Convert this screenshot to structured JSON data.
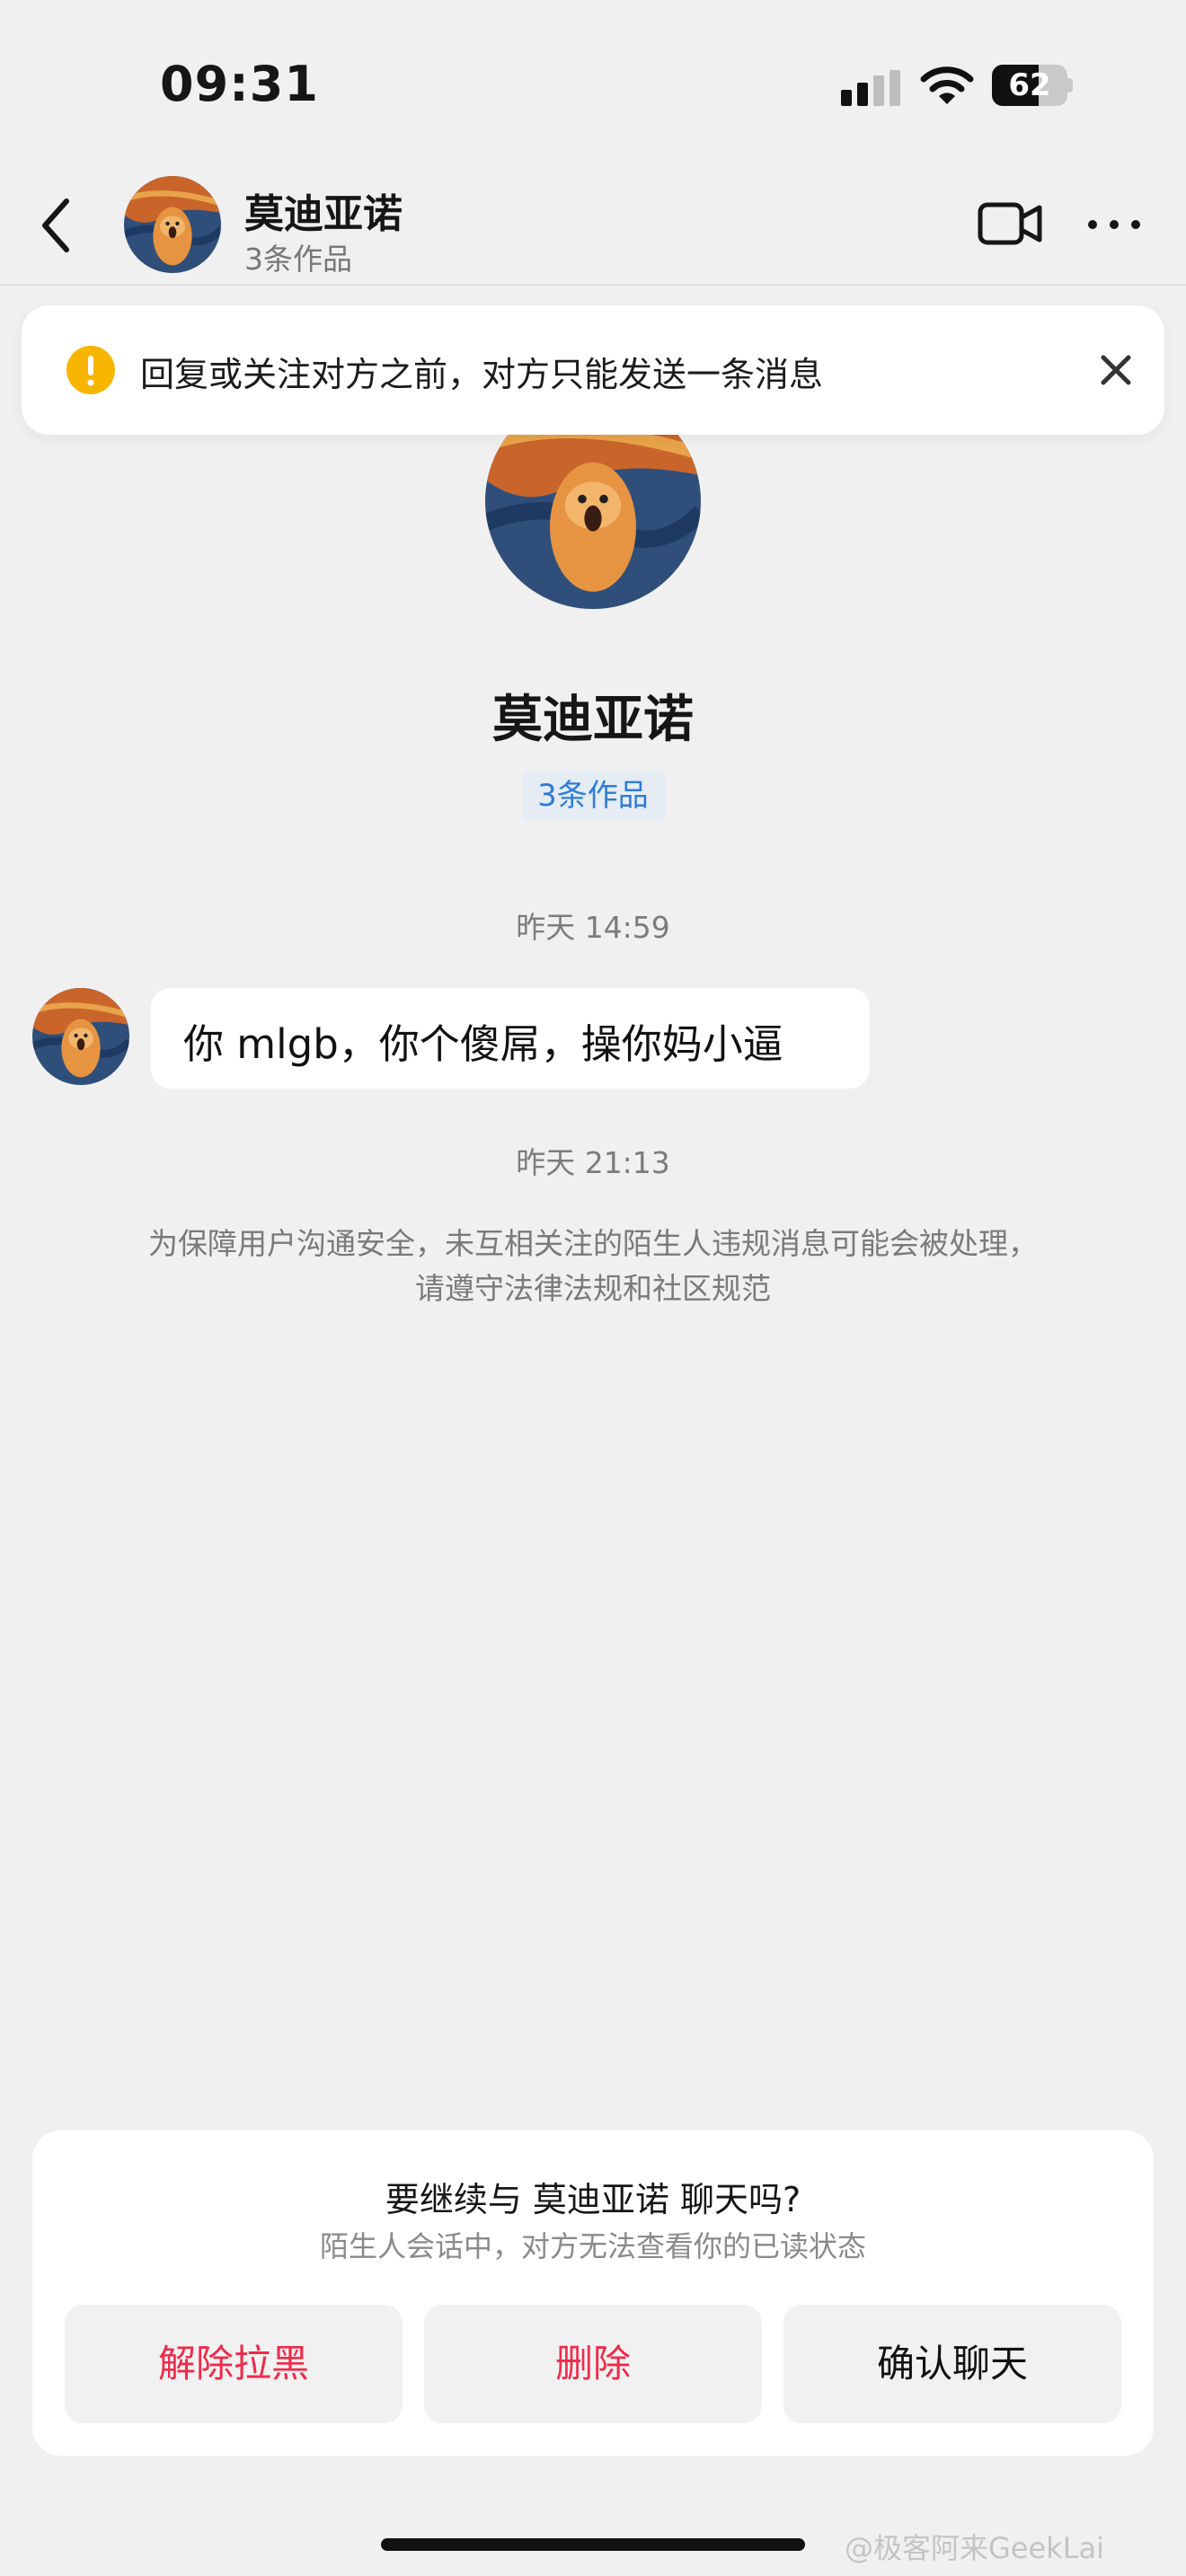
{
  "status_bar": {
    "time": "09:31",
    "battery": "62",
    "battery_level": 0.62
  },
  "header": {
    "name": "莫迪亚诺",
    "subtitle": "3条作品"
  },
  "banner": {
    "text": "回复或关注对方之前，对方只能发送一条消息"
  },
  "profile": {
    "name": "莫迪亚诺",
    "works": "3条作品"
  },
  "chat": {
    "timestamp_1": "昨天 14:59",
    "message_1": "你 mlgb，你个傻屌，操你妈小逼",
    "timestamp_2": "昨天 21:13",
    "system_notice": "为保障用户沟通安全，未互相关注的陌生人违规消息可能会被处理，请遵守法律法规和社区规范"
  },
  "prompt": {
    "title": "要继续与 莫迪亚诺 聊天吗?",
    "subtitle": "陌生人会话中，对方无法查看你的已读状态",
    "unblock_label": "解除拉黑",
    "delete_label": "删除",
    "confirm_label": "确认聊天"
  },
  "watermark": "@极客阿来GeekLai",
  "colors": {
    "accent_red": "#f02a4a",
    "link_blue": "#2f7cd8",
    "warning": "#f7b500"
  }
}
